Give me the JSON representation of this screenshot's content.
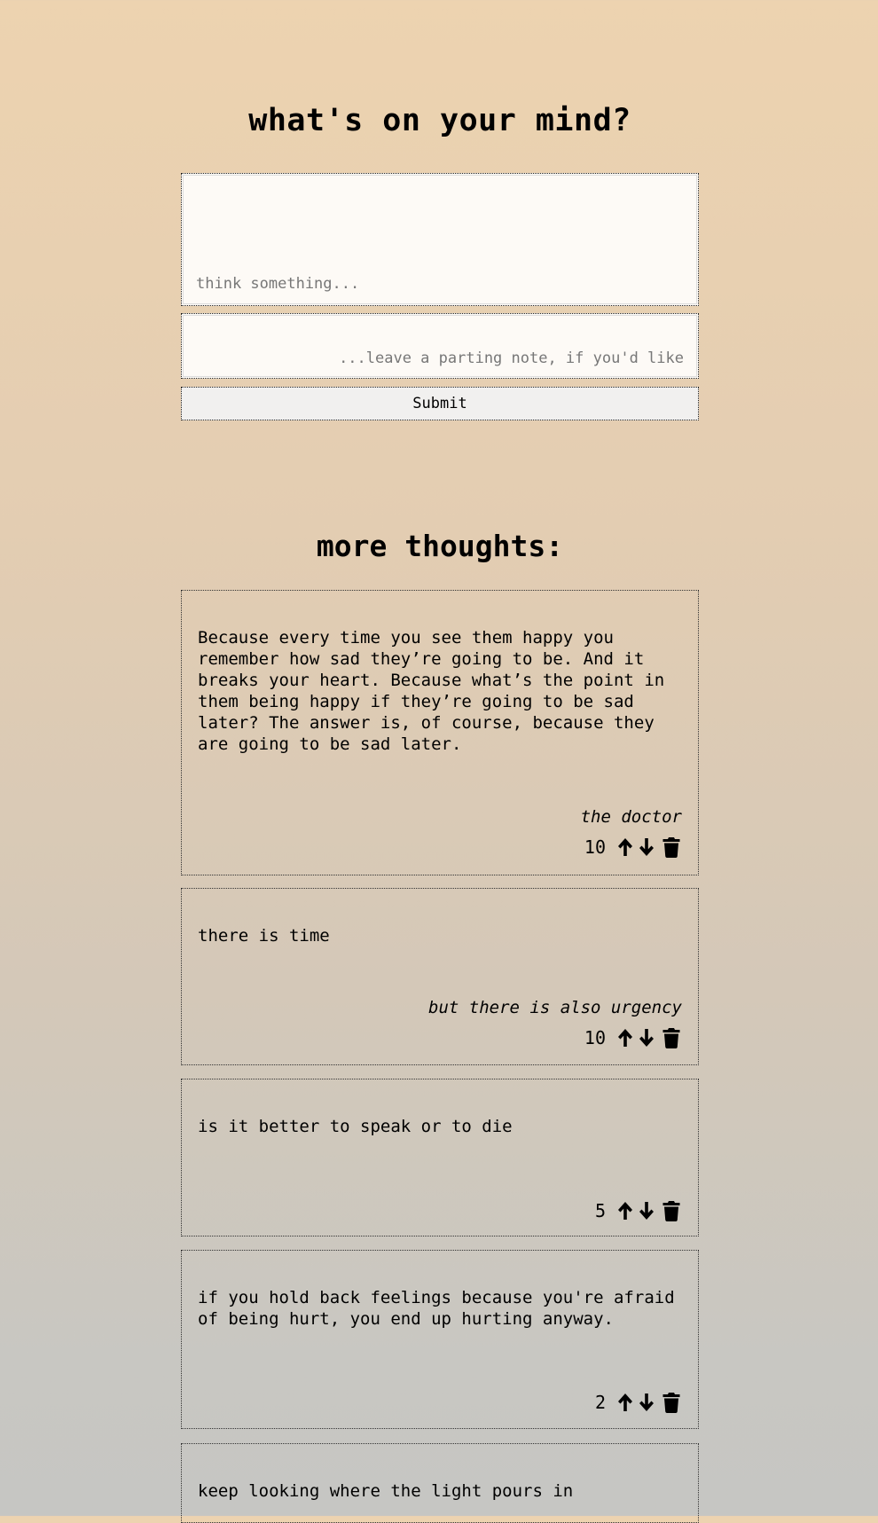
{
  "header": {
    "title": "what's on your mind?"
  },
  "form": {
    "thought_placeholder": "think something...",
    "note_placeholder": "...leave a parting note, if you'd like",
    "submit_label": "Submit"
  },
  "thoughts_section": {
    "title": "more thoughts:"
  },
  "thoughts": [
    {
      "text": "Because every time you see them happy you\nremember how sad they’re going to be. And it\nbreaks your heart. Because what’s the point in\nthem being happy if they’re going to be sad\nlater? The answer is, of course, because they\nare going to be sad later.",
      "note": "the doctor",
      "votes": "10"
    },
    {
      "text": "there is time",
      "note": "but there is also urgency",
      "votes": "10"
    },
    {
      "text": "is it better to speak or to die",
      "note": "",
      "votes": "5"
    },
    {
      "text": "if you hold back feelings because you're afraid\nof being hurt, you end up hurting anyway.",
      "note": "",
      "votes": "2"
    },
    {
      "text": "keep looking where the light pours in",
      "note": "",
      "votes": ""
    }
  ],
  "icons": {
    "upvote": "arrow-up-icon",
    "downvote": "arrow-down-icon",
    "delete": "trash-icon"
  }
}
